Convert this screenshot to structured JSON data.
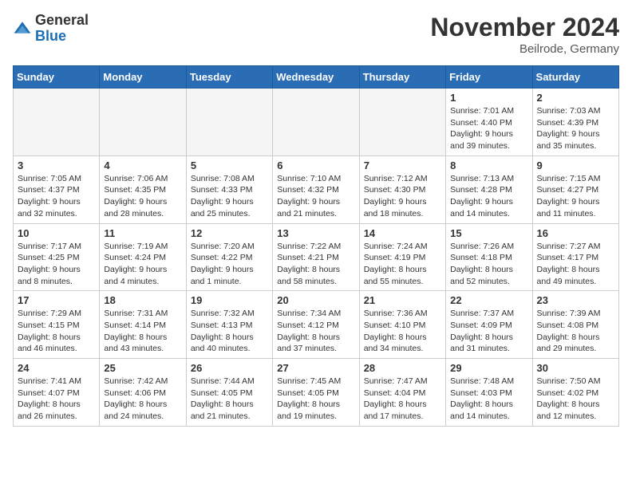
{
  "header": {
    "logo_general": "General",
    "logo_blue": "Blue",
    "month_title": "November 2024",
    "location": "Beilrode, Germany"
  },
  "weekdays": [
    "Sunday",
    "Monday",
    "Tuesday",
    "Wednesday",
    "Thursday",
    "Friday",
    "Saturday"
  ],
  "weeks": [
    [
      {
        "day": "",
        "info": ""
      },
      {
        "day": "",
        "info": ""
      },
      {
        "day": "",
        "info": ""
      },
      {
        "day": "",
        "info": ""
      },
      {
        "day": "",
        "info": ""
      },
      {
        "day": "1",
        "info": "Sunrise: 7:01 AM\nSunset: 4:40 PM\nDaylight: 9 hours\nand 39 minutes."
      },
      {
        "day": "2",
        "info": "Sunrise: 7:03 AM\nSunset: 4:39 PM\nDaylight: 9 hours\nand 35 minutes."
      }
    ],
    [
      {
        "day": "3",
        "info": "Sunrise: 7:05 AM\nSunset: 4:37 PM\nDaylight: 9 hours\nand 32 minutes."
      },
      {
        "day": "4",
        "info": "Sunrise: 7:06 AM\nSunset: 4:35 PM\nDaylight: 9 hours\nand 28 minutes."
      },
      {
        "day": "5",
        "info": "Sunrise: 7:08 AM\nSunset: 4:33 PM\nDaylight: 9 hours\nand 25 minutes."
      },
      {
        "day": "6",
        "info": "Sunrise: 7:10 AM\nSunset: 4:32 PM\nDaylight: 9 hours\nand 21 minutes."
      },
      {
        "day": "7",
        "info": "Sunrise: 7:12 AM\nSunset: 4:30 PM\nDaylight: 9 hours\nand 18 minutes."
      },
      {
        "day": "8",
        "info": "Sunrise: 7:13 AM\nSunset: 4:28 PM\nDaylight: 9 hours\nand 14 minutes."
      },
      {
        "day": "9",
        "info": "Sunrise: 7:15 AM\nSunset: 4:27 PM\nDaylight: 9 hours\nand 11 minutes."
      }
    ],
    [
      {
        "day": "10",
        "info": "Sunrise: 7:17 AM\nSunset: 4:25 PM\nDaylight: 9 hours\nand 8 minutes."
      },
      {
        "day": "11",
        "info": "Sunrise: 7:19 AM\nSunset: 4:24 PM\nDaylight: 9 hours\nand 4 minutes."
      },
      {
        "day": "12",
        "info": "Sunrise: 7:20 AM\nSunset: 4:22 PM\nDaylight: 9 hours\nand 1 minute."
      },
      {
        "day": "13",
        "info": "Sunrise: 7:22 AM\nSunset: 4:21 PM\nDaylight: 8 hours\nand 58 minutes."
      },
      {
        "day": "14",
        "info": "Sunrise: 7:24 AM\nSunset: 4:19 PM\nDaylight: 8 hours\nand 55 minutes."
      },
      {
        "day": "15",
        "info": "Sunrise: 7:26 AM\nSunset: 4:18 PM\nDaylight: 8 hours\nand 52 minutes."
      },
      {
        "day": "16",
        "info": "Sunrise: 7:27 AM\nSunset: 4:17 PM\nDaylight: 8 hours\nand 49 minutes."
      }
    ],
    [
      {
        "day": "17",
        "info": "Sunrise: 7:29 AM\nSunset: 4:15 PM\nDaylight: 8 hours\nand 46 minutes."
      },
      {
        "day": "18",
        "info": "Sunrise: 7:31 AM\nSunset: 4:14 PM\nDaylight: 8 hours\nand 43 minutes."
      },
      {
        "day": "19",
        "info": "Sunrise: 7:32 AM\nSunset: 4:13 PM\nDaylight: 8 hours\nand 40 minutes."
      },
      {
        "day": "20",
        "info": "Sunrise: 7:34 AM\nSunset: 4:12 PM\nDaylight: 8 hours\nand 37 minutes."
      },
      {
        "day": "21",
        "info": "Sunrise: 7:36 AM\nSunset: 4:10 PM\nDaylight: 8 hours\nand 34 minutes."
      },
      {
        "day": "22",
        "info": "Sunrise: 7:37 AM\nSunset: 4:09 PM\nDaylight: 8 hours\nand 31 minutes."
      },
      {
        "day": "23",
        "info": "Sunrise: 7:39 AM\nSunset: 4:08 PM\nDaylight: 8 hours\nand 29 minutes."
      }
    ],
    [
      {
        "day": "24",
        "info": "Sunrise: 7:41 AM\nSunset: 4:07 PM\nDaylight: 8 hours\nand 26 minutes."
      },
      {
        "day": "25",
        "info": "Sunrise: 7:42 AM\nSunset: 4:06 PM\nDaylight: 8 hours\nand 24 minutes."
      },
      {
        "day": "26",
        "info": "Sunrise: 7:44 AM\nSunset: 4:05 PM\nDaylight: 8 hours\nand 21 minutes."
      },
      {
        "day": "27",
        "info": "Sunrise: 7:45 AM\nSunset: 4:05 PM\nDaylight: 8 hours\nand 19 minutes."
      },
      {
        "day": "28",
        "info": "Sunrise: 7:47 AM\nSunset: 4:04 PM\nDaylight: 8 hours\nand 17 minutes."
      },
      {
        "day": "29",
        "info": "Sunrise: 7:48 AM\nSunset: 4:03 PM\nDaylight: 8 hours\nand 14 minutes."
      },
      {
        "day": "30",
        "info": "Sunrise: 7:50 AM\nSunset: 4:02 PM\nDaylight: 8 hours\nand 12 minutes."
      }
    ]
  ]
}
